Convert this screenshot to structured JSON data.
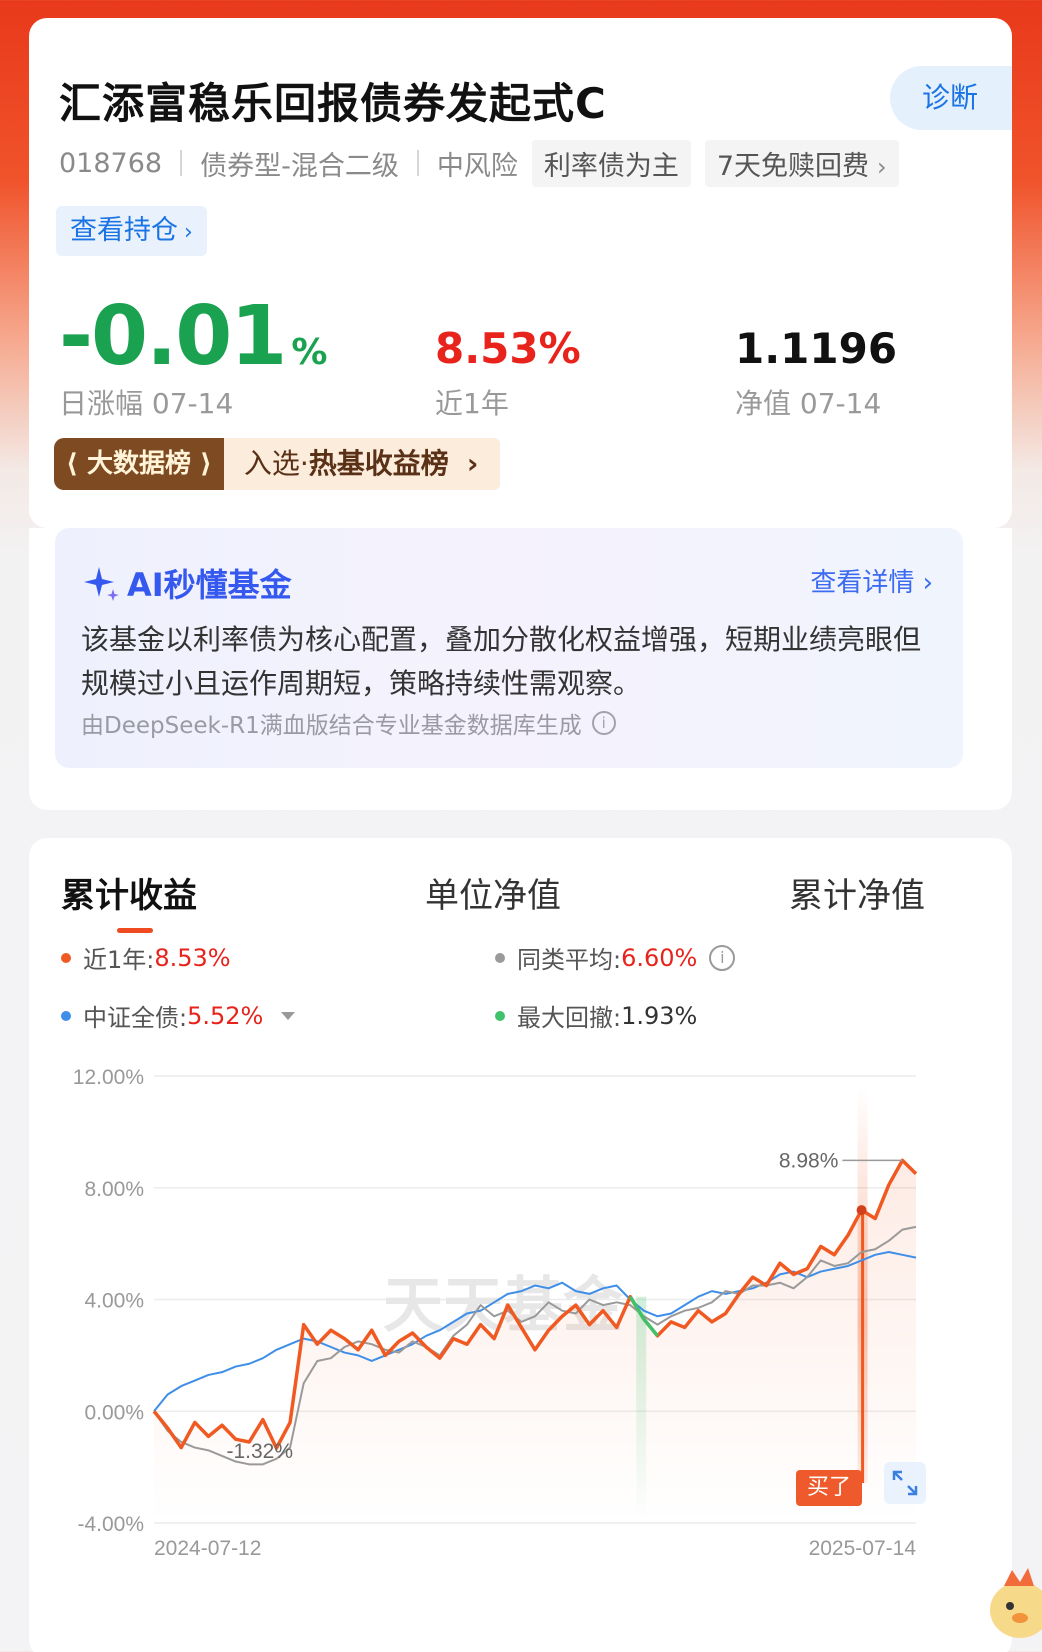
{
  "header": {
    "fund_name": "汇添富稳乐回报债券发起式C",
    "diagnose_label": "诊断",
    "code": "018768",
    "category": "债券型-混合二级",
    "risk": "中风险",
    "tag_strategy": "利率债为主",
    "tag_fee": "7天免赎回费",
    "holdings_link": "查看持仓"
  },
  "stats": {
    "daily_change_value": "-0.01",
    "daily_change_unit": "%",
    "daily_change_label": "日涨幅 07-14",
    "year_return": "8.53%",
    "year_return_label": "近1年",
    "nav": "1.1196",
    "nav_label": "净值 07-14"
  },
  "rank": {
    "badge": "大数据榜",
    "prefix": "入选·",
    "name": "热基收益榜"
  },
  "ai": {
    "title": "AI秒懂基金",
    "more": "查看详情",
    "summary": "该基金以利率债为核心配置，叠加分散化权益增强，短期业绩亮眼但规模过小且运作周期短，策略持续性需观察。",
    "source": "由DeepSeek-R1满血版结合专业基金数据库生成"
  },
  "tabs": [
    "累计收益",
    "单位净值",
    "累计净值"
  ],
  "legend": {
    "fund_label": "近1年:",
    "fund_value": "8.53%",
    "peer_label": "同类平均:",
    "peer_value": "6.60%",
    "index_label": "中证全债:",
    "index_value": "5.52%",
    "drawdown_label": "最大回撤:",
    "drawdown_value": "1.93%"
  },
  "chart_data": {
    "type": "line",
    "x_start": "2024-07-12",
    "x_end": "2025-07-14",
    "y_ticks": [
      "12.00%",
      "8.00%",
      "4.00%",
      "0.00%",
      "-4.00%"
    ],
    "ylim": [
      -4,
      12
    ],
    "annotations": {
      "max": "8.98%",
      "min": "-1.32%"
    },
    "buy_label": "买了",
    "colors": {
      "fund": "#f05a22",
      "peer": "#9a9a9a",
      "index": "#3f8ee8",
      "drawdown": "#3fc26a"
    },
    "series": [
      {
        "name": "近1年",
        "values": [
          0.0,
          -0.6,
          -1.3,
          -0.4,
          -0.9,
          -0.5,
          -1.0,
          -1.1,
          -0.3,
          -1.32,
          -0.4,
          3.1,
          2.4,
          2.9,
          2.6,
          2.2,
          2.9,
          2.0,
          2.5,
          2.8,
          2.3,
          1.9,
          2.6,
          2.4,
          3.1,
          2.6,
          3.8,
          3.0,
          2.2,
          2.9,
          3.4,
          3.8,
          3.1,
          3.6,
          3.0,
          4.1,
          3.3,
          2.7,
          3.2,
          3.0,
          3.6,
          3.2,
          3.5,
          4.2,
          4.8,
          4.5,
          5.3,
          4.9,
          5.1,
          5.9,
          5.6,
          6.3,
          7.2,
          6.9,
          8.1,
          8.98,
          8.5
        ]
      },
      {
        "name": "同类平均",
        "values": [
          0.0,
          -0.7,
          -1.1,
          -1.3,
          -1.4,
          -1.6,
          -1.8,
          -1.9,
          -1.9,
          -1.7,
          -1.3,
          1.0,
          1.8,
          1.9,
          2.3,
          2.5,
          2.4,
          2.2,
          2.1,
          2.5,
          2.3,
          2.0,
          2.7,
          3.1,
          3.8,
          3.4,
          3.6,
          3.2,
          3.4,
          3.9,
          3.6,
          3.5,
          4.0,
          3.8,
          3.9,
          3.8,
          3.4,
          3.1,
          3.4,
          3.6,
          3.7,
          3.9,
          4.3,
          4.2,
          4.5,
          4.5,
          4.6,
          4.4,
          4.8,
          5.4,
          5.2,
          5.3,
          5.7,
          5.8,
          6.1,
          6.5,
          6.6
        ]
      },
      {
        "name": "中证全债",
        "values": [
          0.0,
          0.6,
          0.9,
          1.1,
          1.3,
          1.4,
          1.6,
          1.7,
          1.9,
          2.2,
          2.4,
          2.6,
          2.5,
          2.3,
          2.1,
          2.0,
          1.8,
          2.0,
          2.2,
          2.4,
          2.7,
          2.9,
          3.2,
          3.5,
          3.6,
          3.9,
          4.2,
          4.3,
          4.5,
          4.4,
          4.6,
          4.3,
          4.2,
          4.4,
          4.5,
          4.0,
          3.6,
          3.4,
          3.5,
          3.8,
          4.1,
          4.3,
          4.2,
          4.3,
          4.4,
          4.6,
          4.9,
          5.0,
          4.8,
          5.0,
          5.1,
          5.2,
          5.4,
          5.6,
          5.7,
          5.6,
          5.5
        ]
      }
    ]
  }
}
